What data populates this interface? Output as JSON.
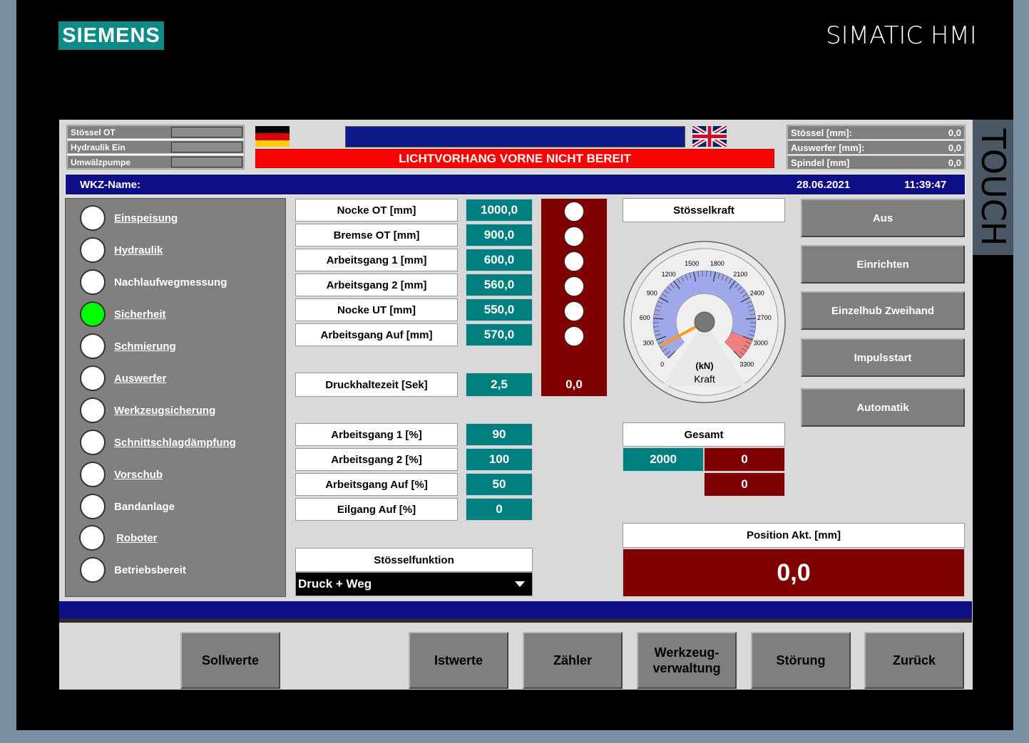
{
  "brand": {
    "logo": "SIEMENS",
    "title": "SIMATIC HMI",
    "touch": "TOUCH"
  },
  "status": [
    {
      "label": "Stössel OT"
    },
    {
      "label": "Hydraulik Ein"
    },
    {
      "label": "Umwälzpumpe"
    }
  ],
  "alarm": "LICHTVORHANG VORNE NICHT BEREIT",
  "readouts": [
    {
      "label": "Stössel [mm]:",
      "value": "0,0"
    },
    {
      "label": "Auswerfer [mm]:",
      "value": "0,0"
    },
    {
      "label": "Spindel [mm]",
      "value": "0,0"
    }
  ],
  "info": {
    "tool_label": "WKZ-Name:",
    "date": "28.06.2021",
    "time": "11:39:47"
  },
  "sidebar": [
    {
      "label": "Einspeisung",
      "link": true,
      "state": "off"
    },
    {
      "label": "Hydraulik",
      "link": true,
      "state": "off"
    },
    {
      "label": "Nachlaufwegmessung",
      "link": false,
      "state": "off"
    },
    {
      "label": "Sicherheit",
      "link": true,
      "state": "on"
    },
    {
      "label": "Schmierung",
      "link": true,
      "state": "off"
    },
    {
      "label": "Auswerfer",
      "link": true,
      "state": "off"
    },
    {
      "label": "Werkzeugsicherung",
      "link": true,
      "state": "off"
    },
    {
      "label": "Schnittschlagdämpfung",
      "link": true,
      "state": "off"
    },
    {
      "label": "Vorschub",
      "link": true,
      "state": "off"
    },
    {
      "label": "Bandanlage",
      "link": false,
      "state": "off"
    },
    {
      "label": "Roboter",
      "link": true,
      "state": "off"
    },
    {
      "label": "Betriebsbereit",
      "link": false,
      "state": "off"
    }
  ],
  "params": [
    {
      "label": "Nocke OT [mm]",
      "value": "1000,0"
    },
    {
      "label": "Bremse OT [mm]",
      "value": "900,0"
    },
    {
      "label": "Arbeitsgang 1 [mm]",
      "value": "600,0"
    },
    {
      "label": "Arbeitsgang 2 [mm]",
      "value": "560,0"
    },
    {
      "label": "Nocke UT [mm]",
      "value": "550,0"
    },
    {
      "label": "Arbeitsgang Auf [mm]",
      "value": "570,0"
    }
  ],
  "dwell": {
    "label": "Druckhaltezeit [Sek]",
    "value": "2,5",
    "cam_value": "0,0"
  },
  "speeds": [
    {
      "label": "Arbeitsgang 1 [%]",
      "value": "90"
    },
    {
      "label": "Arbeitsgang 2 [%]",
      "value": "100"
    },
    {
      "label": "Arbeitsgang Auf [%]",
      "value": "50"
    },
    {
      "label": "Eilgang Auf [%]",
      "value": "0"
    }
  ],
  "ram_function": {
    "title": "Stösselfunktion",
    "selected": "Druck + Weg"
  },
  "force": {
    "title": "Stösselkraft",
    "unit": "(kN)",
    "caption": "Kraft",
    "ticks": [
      "0",
      "300",
      "600",
      "900",
      "1200",
      "1500",
      "1800",
      "2100",
      "2400",
      "2700",
      "3000",
      "3300"
    ],
    "min": 0,
    "max": 3300,
    "value": 200,
    "warn_from": 3000,
    "colors": {
      "scale": "#9fa8e8",
      "warn": "#f08080",
      "needle": "#ff9a1a"
    }
  },
  "total": {
    "title": "Gesamt",
    "set": "2000",
    "count": "0",
    "count2": "0"
  },
  "position": {
    "title": "Position Akt. [mm]",
    "value": "0,0"
  },
  "modes": [
    "Aus",
    "Einrichten",
    "Einzelhub Zweihand",
    "Impulsstart",
    "Automatik"
  ],
  "nav": [
    "Sollwerte",
    "Istwerte",
    "Zähler",
    "Werkzeug-\nverwaltung",
    "Störung",
    "Zurück"
  ]
}
